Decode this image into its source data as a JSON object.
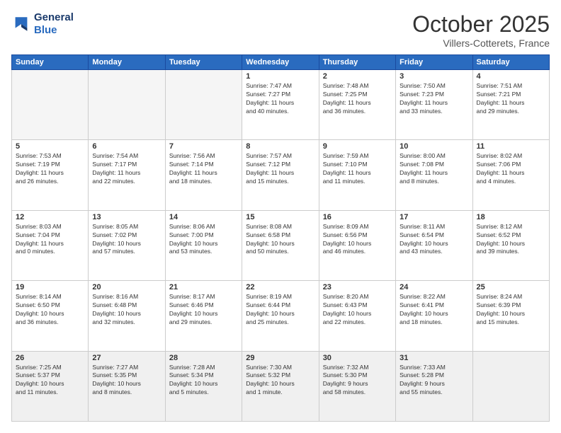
{
  "logo": {
    "line1": "General",
    "line2": "Blue"
  },
  "title": "October 2025",
  "location": "Villers-Cotterets, France",
  "weekdays": [
    "Sunday",
    "Monday",
    "Tuesday",
    "Wednesday",
    "Thursday",
    "Friday",
    "Saturday"
  ],
  "weeks": [
    [
      {
        "day": "",
        "info": ""
      },
      {
        "day": "",
        "info": ""
      },
      {
        "day": "",
        "info": ""
      },
      {
        "day": "1",
        "info": "Sunrise: 7:47 AM\nSunset: 7:27 PM\nDaylight: 11 hours\nand 40 minutes."
      },
      {
        "day": "2",
        "info": "Sunrise: 7:48 AM\nSunset: 7:25 PM\nDaylight: 11 hours\nand 36 minutes."
      },
      {
        "day": "3",
        "info": "Sunrise: 7:50 AM\nSunset: 7:23 PM\nDaylight: 11 hours\nand 33 minutes."
      },
      {
        "day": "4",
        "info": "Sunrise: 7:51 AM\nSunset: 7:21 PM\nDaylight: 11 hours\nand 29 minutes."
      }
    ],
    [
      {
        "day": "5",
        "info": "Sunrise: 7:53 AM\nSunset: 7:19 PM\nDaylight: 11 hours\nand 26 minutes."
      },
      {
        "day": "6",
        "info": "Sunrise: 7:54 AM\nSunset: 7:17 PM\nDaylight: 11 hours\nand 22 minutes."
      },
      {
        "day": "7",
        "info": "Sunrise: 7:56 AM\nSunset: 7:14 PM\nDaylight: 11 hours\nand 18 minutes."
      },
      {
        "day": "8",
        "info": "Sunrise: 7:57 AM\nSunset: 7:12 PM\nDaylight: 11 hours\nand 15 minutes."
      },
      {
        "day": "9",
        "info": "Sunrise: 7:59 AM\nSunset: 7:10 PM\nDaylight: 11 hours\nand 11 minutes."
      },
      {
        "day": "10",
        "info": "Sunrise: 8:00 AM\nSunset: 7:08 PM\nDaylight: 11 hours\nand 8 minutes."
      },
      {
        "day": "11",
        "info": "Sunrise: 8:02 AM\nSunset: 7:06 PM\nDaylight: 11 hours\nand 4 minutes."
      }
    ],
    [
      {
        "day": "12",
        "info": "Sunrise: 8:03 AM\nSunset: 7:04 PM\nDaylight: 11 hours\nand 0 minutes."
      },
      {
        "day": "13",
        "info": "Sunrise: 8:05 AM\nSunset: 7:02 PM\nDaylight: 10 hours\nand 57 minutes."
      },
      {
        "day": "14",
        "info": "Sunrise: 8:06 AM\nSunset: 7:00 PM\nDaylight: 10 hours\nand 53 minutes."
      },
      {
        "day": "15",
        "info": "Sunrise: 8:08 AM\nSunset: 6:58 PM\nDaylight: 10 hours\nand 50 minutes."
      },
      {
        "day": "16",
        "info": "Sunrise: 8:09 AM\nSunset: 6:56 PM\nDaylight: 10 hours\nand 46 minutes."
      },
      {
        "day": "17",
        "info": "Sunrise: 8:11 AM\nSunset: 6:54 PM\nDaylight: 10 hours\nand 43 minutes."
      },
      {
        "day": "18",
        "info": "Sunrise: 8:12 AM\nSunset: 6:52 PM\nDaylight: 10 hours\nand 39 minutes."
      }
    ],
    [
      {
        "day": "19",
        "info": "Sunrise: 8:14 AM\nSunset: 6:50 PM\nDaylight: 10 hours\nand 36 minutes."
      },
      {
        "day": "20",
        "info": "Sunrise: 8:16 AM\nSunset: 6:48 PM\nDaylight: 10 hours\nand 32 minutes."
      },
      {
        "day": "21",
        "info": "Sunrise: 8:17 AM\nSunset: 6:46 PM\nDaylight: 10 hours\nand 29 minutes."
      },
      {
        "day": "22",
        "info": "Sunrise: 8:19 AM\nSunset: 6:44 PM\nDaylight: 10 hours\nand 25 minutes."
      },
      {
        "day": "23",
        "info": "Sunrise: 8:20 AM\nSunset: 6:43 PM\nDaylight: 10 hours\nand 22 minutes."
      },
      {
        "day": "24",
        "info": "Sunrise: 8:22 AM\nSunset: 6:41 PM\nDaylight: 10 hours\nand 18 minutes."
      },
      {
        "day": "25",
        "info": "Sunrise: 8:24 AM\nSunset: 6:39 PM\nDaylight: 10 hours\nand 15 minutes."
      }
    ],
    [
      {
        "day": "26",
        "info": "Sunrise: 7:25 AM\nSunset: 5:37 PM\nDaylight: 10 hours\nand 11 minutes."
      },
      {
        "day": "27",
        "info": "Sunrise: 7:27 AM\nSunset: 5:35 PM\nDaylight: 10 hours\nand 8 minutes."
      },
      {
        "day": "28",
        "info": "Sunrise: 7:28 AM\nSunset: 5:34 PM\nDaylight: 10 hours\nand 5 minutes."
      },
      {
        "day": "29",
        "info": "Sunrise: 7:30 AM\nSunset: 5:32 PM\nDaylight: 10 hours\nand 1 minute."
      },
      {
        "day": "30",
        "info": "Sunrise: 7:32 AM\nSunset: 5:30 PM\nDaylight: 9 hours\nand 58 minutes."
      },
      {
        "day": "31",
        "info": "Sunrise: 7:33 AM\nSunset: 5:28 PM\nDaylight: 9 hours\nand 55 minutes."
      },
      {
        "day": "",
        "info": ""
      }
    ]
  ]
}
